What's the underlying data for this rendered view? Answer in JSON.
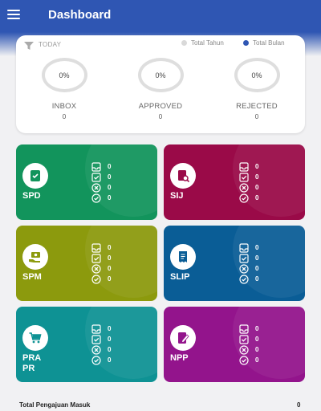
{
  "header": {
    "title": "Dashboard"
  },
  "summary": {
    "today_label": "TODAY",
    "legend": [
      {
        "label": "Total Tahun",
        "color": "#d9d9d9"
      },
      {
        "label": "Total Bulan",
        "color": "#2f56b3"
      }
    ],
    "stats": [
      {
        "percent": "0%",
        "label": "INBOX",
        "count": "0"
      },
      {
        "percent": "0%",
        "label": "APPROVED",
        "count": "0"
      },
      {
        "percent": "0%",
        "label": "REJECTED",
        "count": "0"
      }
    ]
  },
  "tiles": [
    {
      "name": "SPD",
      "color": "#12945c",
      "icon": "clipboard-check-icon",
      "counts": [
        "0",
        "0",
        "0",
        "0"
      ]
    },
    {
      "name": "SIJ",
      "color": "#9a0a48",
      "icon": "document-search-icon",
      "counts": [
        "0",
        "0",
        "0",
        "0"
      ]
    },
    {
      "name": "SPM",
      "color": "#8c9a0d",
      "icon": "money-hand-icon",
      "counts": [
        "0",
        "0",
        "0",
        "0"
      ]
    },
    {
      "name": "SLIP",
      "color": "#0a5d96",
      "icon": "receipt-icon",
      "counts": [
        "0",
        "0",
        "0",
        "0"
      ]
    },
    {
      "name": "PRA\nPR",
      "color": "#0e9294",
      "icon": "cart-icon",
      "counts": [
        "0",
        "0",
        "0",
        "0"
      ]
    },
    {
      "name": "NPP",
      "color": "#93148c",
      "icon": "document-edit-icon",
      "counts": [
        "0",
        "0",
        "0",
        "0"
      ]
    }
  ],
  "footer": {
    "label": "Total Pengajuan Masuk",
    "value": "0"
  }
}
